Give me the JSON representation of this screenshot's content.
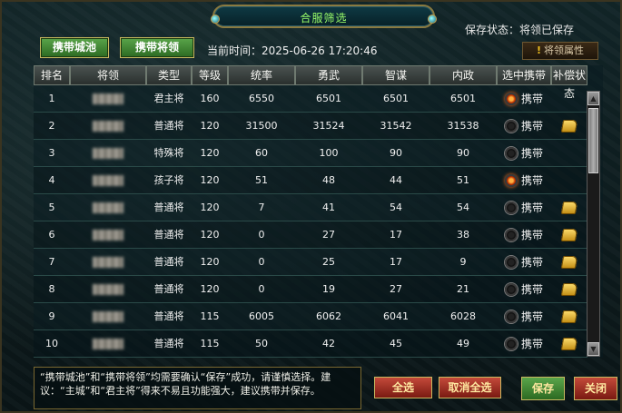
{
  "title": "合服筛选",
  "save_status": {
    "label": "保存状态：",
    "value": "将领已保存"
  },
  "top_buttons": {
    "carry_city": "携带城池",
    "carry_general": "携带将领"
  },
  "current_time": {
    "label": "当前时间：",
    "value": "2025-06-26 17:20:46"
  },
  "general_attr_button": "将领属性",
  "table": {
    "headers": [
      "排名",
      "将领",
      "类型",
      "等级",
      "统率",
      "勇武",
      "智谋",
      "内政",
      "选中携带",
      "补偿状态"
    ],
    "carry_label": "携带",
    "rows": [
      {
        "rank": "1",
        "type": "君主将",
        "level": "160",
        "lead": "6550",
        "force": "6501",
        "int": "6501",
        "pol": "6501",
        "selected": true,
        "compensation": false
      },
      {
        "rank": "2",
        "type": "普通将",
        "level": "120",
        "lead": "31500",
        "force": "31524",
        "int": "31542",
        "pol": "31538",
        "selected": false,
        "compensation": true
      },
      {
        "rank": "3",
        "type": "特殊将",
        "level": "120",
        "lead": "60",
        "force": "100",
        "int": "90",
        "pol": "90",
        "selected": false,
        "compensation": false
      },
      {
        "rank": "4",
        "type": "孩子将",
        "level": "120",
        "lead": "51",
        "force": "48",
        "int": "44",
        "pol": "51",
        "selected": true,
        "compensation": false
      },
      {
        "rank": "5",
        "type": "普通将",
        "level": "120",
        "lead": "7",
        "force": "41",
        "int": "54",
        "pol": "54",
        "selected": false,
        "compensation": true
      },
      {
        "rank": "6",
        "type": "普通将",
        "level": "120",
        "lead": "0",
        "force": "27",
        "int": "17",
        "pol": "38",
        "selected": false,
        "compensation": true
      },
      {
        "rank": "7",
        "type": "普通将",
        "level": "120",
        "lead": "0",
        "force": "25",
        "int": "17",
        "pol": "9",
        "selected": false,
        "compensation": true
      },
      {
        "rank": "8",
        "type": "普通将",
        "level": "120",
        "lead": "0",
        "force": "19",
        "int": "27",
        "pol": "21",
        "selected": false,
        "compensation": true
      },
      {
        "rank": "9",
        "type": "普通将",
        "level": "115",
        "lead": "6005",
        "force": "6062",
        "int": "6041",
        "pol": "6028",
        "selected": false,
        "compensation": true
      },
      {
        "rank": "10",
        "type": "普通将",
        "level": "115",
        "lead": "50",
        "force": "42",
        "int": "45",
        "pol": "49",
        "selected": false,
        "compensation": true
      }
    ]
  },
  "notice": "“携带城池”和“携带将领”均需要确认“保存”成功，请谨慎选择。建议：“主城”和“君主将”得来不易且功能强大，建议携带并保存。",
  "bottom_buttons": {
    "select_all": "全选",
    "cancel_all": "取消全选",
    "save": "保存",
    "close": "关闭"
  },
  "colors": {
    "title_text": "#9aff6a",
    "green_button": "#3c7a30",
    "red_button": "#a03020",
    "selected_radio": "#ff7020"
  }
}
